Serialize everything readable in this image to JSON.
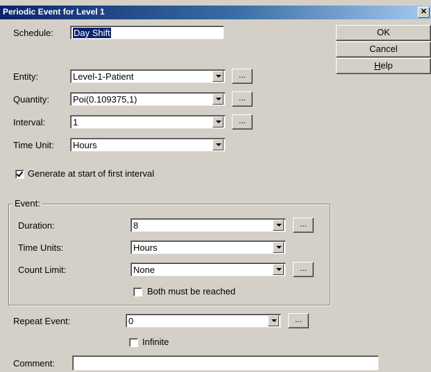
{
  "window": {
    "title": "Periodic Event for Level 1",
    "close_glyph": "✕"
  },
  "buttons": {
    "ok": "OK",
    "cancel": "Cancel",
    "help_mnemonic": "H",
    "help_rest": "elp",
    "browse": "..."
  },
  "form": {
    "schedule": {
      "label": "Schedule:",
      "value": "Day Shift"
    },
    "entity": {
      "label": "Entity:",
      "value": "Level-1-Patient"
    },
    "quantity": {
      "label": "Quantity:",
      "value": "Poi(0.109375,1)"
    },
    "interval": {
      "label": "Interval:",
      "value": "1"
    },
    "time_unit": {
      "label": "Time Unit:",
      "value": "Hours"
    },
    "generate_first": {
      "label": "Generate at start of first interval",
      "checked": true
    }
  },
  "event_group": {
    "legend": "Event:",
    "duration": {
      "label": "Duration:",
      "value": "8"
    },
    "time_units": {
      "label": "Time Units:",
      "value": "Hours"
    },
    "count_limit": {
      "label": "Count Limit:",
      "value": "None"
    },
    "both_reached": {
      "label": "Both must be reached",
      "checked": false
    }
  },
  "repeat": {
    "label": "Repeat Event:",
    "value": "0",
    "infinite": {
      "label": "Infinite",
      "checked": false
    }
  },
  "comment": {
    "label": "Comment:",
    "value": ""
  }
}
